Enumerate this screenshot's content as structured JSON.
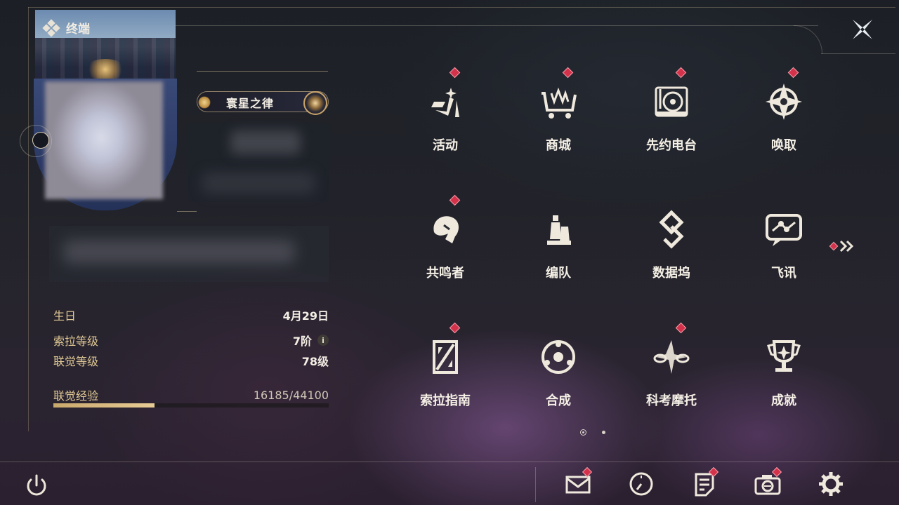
{
  "window": {
    "title": "终端",
    "close_label": "close"
  },
  "profile": {
    "title_badge": "寰星之律",
    "info": [
      {
        "label": "生日",
        "value": "4月29日"
      },
      {
        "label": "索拉等级",
        "value": "7阶"
      },
      {
        "label": "联觉等级",
        "value": "78级"
      }
    ],
    "level_info_icon": "i",
    "exp": {
      "label": "联觉经验",
      "value": "16185/44100",
      "current": 16185,
      "max": 44100
    }
  },
  "menu": {
    "items": [
      {
        "label": "活动",
        "icon": "activity-icon",
        "badge": true
      },
      {
        "label": "商城",
        "icon": "shop-cart-icon",
        "badge": true
      },
      {
        "label": "先约电台",
        "icon": "radio-icon",
        "badge": true
      },
      {
        "label": "唤取",
        "icon": "summon-icon",
        "badge": true
      },
      {
        "label": "共鸣者",
        "icon": "resonator-icon",
        "badge": true
      },
      {
        "label": "编队",
        "icon": "chess-team-icon",
        "badge": false
      },
      {
        "label": "数据坞",
        "icon": "data-bank-icon",
        "badge": false
      },
      {
        "label": "飞讯",
        "icon": "message-icon",
        "badge": false
      },
      {
        "label": "索拉指南",
        "icon": "guide-book-icon",
        "badge": true
      },
      {
        "label": "合成",
        "icon": "synthesis-icon",
        "badge": false
      },
      {
        "label": "科考摩托",
        "icon": "motorcycle-icon",
        "badge": true
      },
      {
        "label": "成就",
        "icon": "trophy-icon",
        "badge": false
      }
    ],
    "next_page_icon": "chevron-double-right-icon",
    "pages": 2,
    "current_page": 1
  },
  "bottom_bar": {
    "buttons": [
      {
        "name": "mail",
        "icon": "mail-icon",
        "badge": true
      },
      {
        "name": "clock",
        "icon": "clock-icon",
        "badge": false
      },
      {
        "name": "notes",
        "icon": "notes-icon",
        "badge": true
      },
      {
        "name": "camera",
        "icon": "camera-icon",
        "badge": true
      },
      {
        "name": "settings",
        "icon": "gear-icon",
        "badge": false
      }
    ],
    "power_icon": "power-icon"
  },
  "colors": {
    "accent_gold": "#e0c994",
    "badge_red": "#d3324a",
    "text": "#f5f0e6"
  }
}
